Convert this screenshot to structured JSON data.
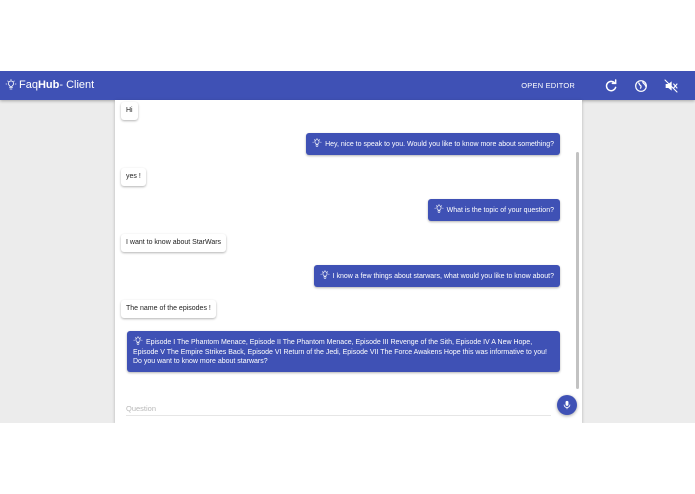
{
  "toolbar": {
    "brand_prefix": "Faq",
    "brand_bold": "Hub",
    "brand_suffix": " - Client",
    "open_editor_label": "OPEN EDITOR",
    "icons": [
      "lightbulb-icon",
      "refresh-icon",
      "globe-icon",
      "volume-off-icon"
    ]
  },
  "chat": {
    "messages": [
      {
        "from": "user",
        "text": "Hi"
      },
      {
        "from": "bot",
        "text": "Hey, nice to speak to you. Would you like to know more about something?"
      },
      {
        "from": "user",
        "text": "yes !"
      },
      {
        "from": "bot",
        "text": "What is the topic of your question?"
      },
      {
        "from": "user",
        "text": "I want to know about StarWars"
      },
      {
        "from": "bot",
        "text": "I know a few things about starwars, what would you like to know about?"
      },
      {
        "from": "user",
        "text": "The name of the episodes !"
      },
      {
        "from": "bot",
        "text": "Episode I The Phantom Menace, Episode II The Phantom Menace, Episode III Revenge of the Sith, Episode IV A New Hope, Episode V The Empire Strikes Back, Episode VI Return of the Jedi, Episode VII The Force Awakens Hope this was informative to you! Do you want to know more about starwars?"
      }
    ]
  },
  "input": {
    "placeholder": "Question",
    "value": ""
  },
  "colors": {
    "primary": "#3f51b5",
    "background": "#ececec"
  }
}
